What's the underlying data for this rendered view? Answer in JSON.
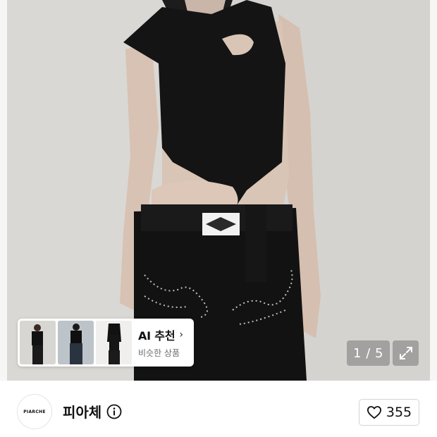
{
  "ai_recommendation": {
    "title": "AI 추천",
    "chevron": "›",
    "subtitle": "비슷한 상품",
    "thumbnails": [
      "model-thumbnail-1",
      "model-thumbnail-2",
      "model-thumbnail-3"
    ]
  },
  "image_counter": {
    "text": "1 / 5"
  },
  "brand": {
    "logo_text": "PIARCHE",
    "name": "피아체"
  },
  "like": {
    "count": "355"
  },
  "icons": {
    "expand": "expand-arrows-icon",
    "info": "info-circle-icon",
    "like": "heart-outline-icon"
  },
  "colors": {
    "background": "#ffffff",
    "image_backdrop": "#f6f6f5",
    "overlay": "#787878"
  }
}
